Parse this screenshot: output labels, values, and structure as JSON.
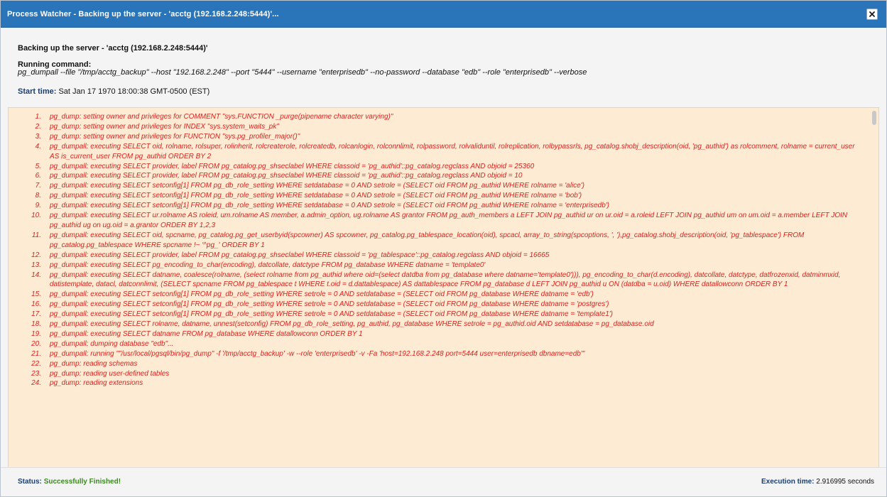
{
  "window": {
    "title": "Process Watcher - Backing up the server - 'acctg (192.168.2.248:5444)'...",
    "close_icon": "close-icon"
  },
  "header": {
    "heading": "Backing up the server - 'acctg (192.168.2.248:5444)'",
    "running_label": "Running command:",
    "command": "pg_dumpall --file \"/tmp/acctg_backup\" --host \"192.168.2.248\" --port \"5444\" --username \"enterprisedb\" --no-password --database \"edb\" --role \"enterprisedb\" --verbose",
    "start_time_label": "Start time:",
    "start_time_value": "Sat Jan 17 1970 18:00:38 GMT-0500 (EST)"
  },
  "log": {
    "items": [
      {
        "num": "1.",
        "text": "pg_dump: setting owner and privileges for COMMENT \"sys.FUNCTION _purge(pipename character varying)\""
      },
      {
        "num": "2.",
        "text": "pg_dump: setting owner and privileges for INDEX \"sys.system_waits_pk\""
      },
      {
        "num": "3.",
        "text": "pg_dump: setting owner and privileges for FUNCTION \"sys.pg_profiler_major()\""
      },
      {
        "num": "4.",
        "text": "pg_dumpall: executing SELECT oid, rolname, rolsuper, rolinherit, rolcreaterole, rolcreatedb, rolcanlogin, rolconnlimit, rolpassword, rolvaliduntil, rolreplication, rolbypassrls, pg_catalog.shobj_description(oid, 'pg_authid') as rolcomment, rolname = current_user AS is_current_user FROM pg_authid ORDER BY 2"
      },
      {
        "num": "5.",
        "text": "pg_dumpall: executing SELECT provider, label FROM pg_catalog.pg_shseclabel WHERE classoid = 'pg_authid'::pg_catalog.regclass AND objoid = 25360"
      },
      {
        "num": "6.",
        "text": "pg_dumpall: executing SELECT provider, label FROM pg_catalog.pg_shseclabel WHERE classoid = 'pg_authid'::pg_catalog.regclass AND objoid = 10"
      },
      {
        "num": "7.",
        "text": "pg_dumpall: executing SELECT setconfig[1] FROM pg_db_role_setting WHERE setdatabase = 0 AND setrole = (SELECT oid FROM pg_authid WHERE rolname = 'alice')"
      },
      {
        "num": "8.",
        "text": "pg_dumpall: executing SELECT setconfig[1] FROM pg_db_role_setting WHERE setdatabase = 0 AND setrole = (SELECT oid FROM pg_authid WHERE rolname = 'bob')"
      },
      {
        "num": "9.",
        "text": "pg_dumpall: executing SELECT setconfig[1] FROM pg_db_role_setting WHERE setdatabase = 0 AND setrole = (SELECT oid FROM pg_authid WHERE rolname = 'enterprisedb')"
      },
      {
        "num": "10.",
        "text": "pg_dumpall: executing SELECT ur.rolname AS roleid, um.rolname AS member, a.admin_option, ug.rolname AS grantor FROM pg_auth_members a LEFT JOIN pg_authid ur on ur.oid = a.roleid LEFT JOIN pg_authid um on um.oid = a.member LEFT JOIN pg_authid ug on ug.oid = a.grantor ORDER BY 1,2,3"
      },
      {
        "num": "11.",
        "text": "pg_dumpall: executing SELECT oid, spcname, pg_catalog.pg_get_userbyid(spcowner) AS spcowner, pg_catalog.pg_tablespace_location(oid), spcacl, array_to_string(spcoptions, ', '),pg_catalog.shobj_description(oid, 'pg_tablespace') FROM pg_catalog.pg_tablespace WHERE spcname !~ '^pg_' ORDER BY 1"
      },
      {
        "num": "12.",
        "text": "pg_dumpall: executing SELECT provider, label FROM pg_catalog.pg_shseclabel WHERE classoid = 'pg_tablespace'::pg_catalog.regclass AND objoid = 16665"
      },
      {
        "num": "13.",
        "text": "pg_dumpall: executing SELECT pg_encoding_to_char(encoding), datcollate, datctype FROM pg_database WHERE datname = 'template0'"
      },
      {
        "num": "14.",
        "text": "pg_dumpall: executing SELECT datname, coalesce(rolname, (select rolname from pg_authid where oid=(select datdba from pg_database where datname='template0'))), pg_encoding_to_char(d.encoding), datcollate, datctype, datfrozenxid, datminmxid, datistemplate, datacl, datconnlimit, (SELECT spcname FROM pg_tablespace t WHERE t.oid = d.dattablespace) AS dattablespace FROM pg_database d LEFT JOIN pg_authid u ON (datdba = u.oid) WHERE datallowconn ORDER BY 1"
      },
      {
        "num": "15.",
        "text": "pg_dumpall: executing SELECT setconfig[1] FROM pg_db_role_setting WHERE setrole = 0 AND setdatabase = (SELECT oid FROM pg_database WHERE datname = 'edb')"
      },
      {
        "num": "16.",
        "text": "pg_dumpall: executing SELECT setconfig[1] FROM pg_db_role_setting WHERE setrole = 0 AND setdatabase = (SELECT oid FROM pg_database WHERE datname = 'postgres')"
      },
      {
        "num": "17.",
        "text": "pg_dumpall: executing SELECT setconfig[1] FROM pg_db_role_setting WHERE setrole = 0 AND setdatabase = (SELECT oid FROM pg_database WHERE datname = 'template1')"
      },
      {
        "num": "18.",
        "text": "pg_dumpall: executing SELECT rolname, datname, unnest(setconfig) FROM pg_db_role_setting, pg_authid, pg_database WHERE setrole = pg_authid.oid AND setdatabase = pg_database.oid"
      },
      {
        "num": "19.",
        "text": "pg_dumpall: executing SELECT datname FROM pg_database WHERE datallowconn ORDER BY 1"
      },
      {
        "num": "20.",
        "text": "pg_dumpall: dumping database \"edb\"..."
      },
      {
        "num": "21.",
        "text": "pg_dumpall: running \"\"/usr/local/pgsql/bin/pg_dump\" -f '/tmp/acctg_backup' -w --role 'enterprisedb' -v -Fa 'host=192.168.2.248 port=5444 user=enterprisedb dbname=edb'\""
      },
      {
        "num": "22.",
        "text": "pg_dump: reading schemas"
      },
      {
        "num": "23.",
        "text": "pg_dump: reading user-defined tables"
      },
      {
        "num": "24.",
        "text": "pg_dump: reading extensions"
      }
    ]
  },
  "footer": {
    "status_label": "Status:",
    "status_value": "Successfully Finished!",
    "exec_label": "Execution time:",
    "exec_value": "2.916995 seconds"
  },
  "colors": {
    "titlebar": "#2a74b9",
    "log_background": "#fdebd4",
    "log_text": "#d8231e",
    "status_success": "#3a8a1c"
  }
}
